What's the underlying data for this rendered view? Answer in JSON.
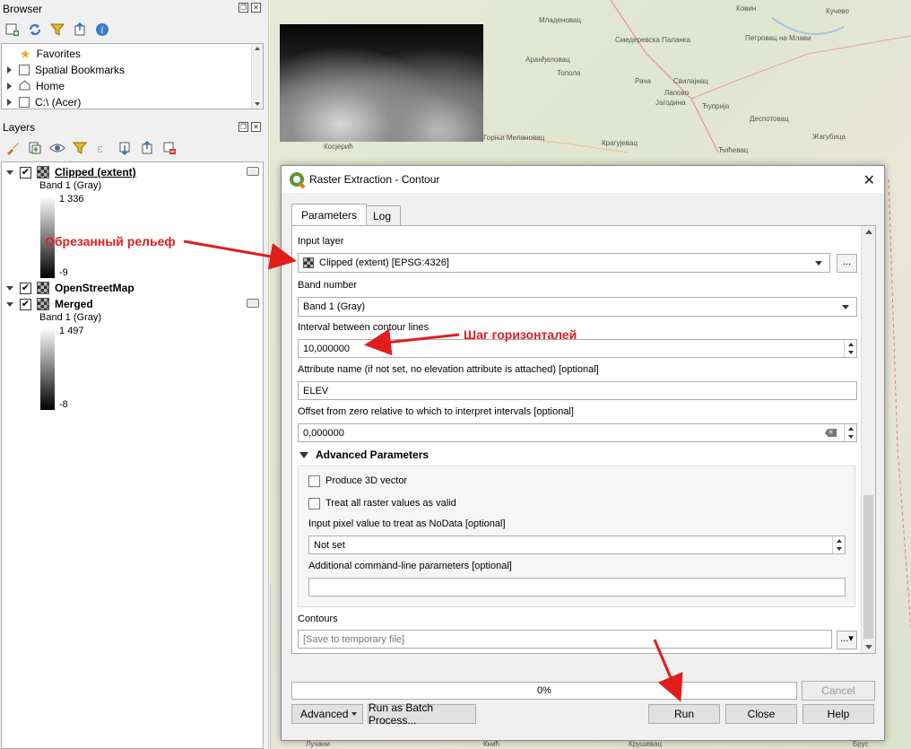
{
  "browser": {
    "title": "Browser",
    "items": [
      {
        "label": "Favorites"
      },
      {
        "label": "Spatial Bookmarks"
      },
      {
        "label": "Home"
      },
      {
        "label": "C:\\ (Acer)"
      }
    ]
  },
  "layers": {
    "title": "Layers",
    "items": [
      {
        "name": "Clipped (extent)",
        "band": "Band 1 (Gray)",
        "max": "1 336",
        "min": "-9",
        "checked": true
      },
      {
        "name": "OpenStreetMap",
        "checked": true
      },
      {
        "name": "Merged",
        "band": "Band 1 (Gray)",
        "max": "1 497",
        "min": "-8",
        "checked": true
      }
    ]
  },
  "annotations": {
    "relief": "Обрезанный рельеф",
    "contour_step": "Шаг горизонталей"
  },
  "map": {
    "labels": [
      "Младеновац",
      "Смедеревска Паланка",
      "Аранђеловац",
      "Топола",
      "Рача",
      "Свилајнац",
      "Лапово",
      "Јагодина",
      "Ћуприја",
      "Крагујевац",
      "Деспотовац",
      "Петровац на Млави",
      "Кучево",
      "Ковин",
      "Жагубица",
      "Косјерић",
      "Горњи Милановац",
      "Ћићевац",
      "Кнић",
      "Лучани",
      "Крушевац",
      "Брус"
    ]
  },
  "dialog": {
    "title": "Raster Extraction - Contour",
    "tabs": {
      "parameters": "Parameters",
      "log": "Log"
    },
    "input_layer_label": "Input layer",
    "input_layer_value": "Clipped (extent) [EPSG:4326]",
    "band_label": "Band number",
    "band_value": "Band 1 (Gray)",
    "interval_label": "Interval between contour lines",
    "interval_value": "10,000000",
    "attribute_label": "Attribute name (if not set, no elevation attribute is attached) [optional]",
    "attribute_value": "ELEV",
    "offset_label": "Offset from zero relative to which to interpret intervals [optional]",
    "offset_value": "0,000000",
    "advanced_header": "Advanced Parameters",
    "produce3d_label": "Produce 3D vector",
    "treat_all_label": "Treat all raster values as valid",
    "nodata_label": "Input pixel value to treat as NoData [optional]",
    "nodata_value": "Not set",
    "extra_label": "Additional command-line parameters [optional]",
    "extra_value": "",
    "contours_label": "Contours",
    "contours_placeholder": "[Save to temporary file]",
    "progress": "0%",
    "progress_fraction": 0,
    "buttons": {
      "cancel": "Cancel",
      "advanced": "Advanced",
      "batch": "Run as Batch Process...",
      "run": "Run",
      "close": "Close",
      "help": "Help",
      "dots": "..."
    }
  },
  "colors": {
    "annotation": "#e11d1d"
  }
}
